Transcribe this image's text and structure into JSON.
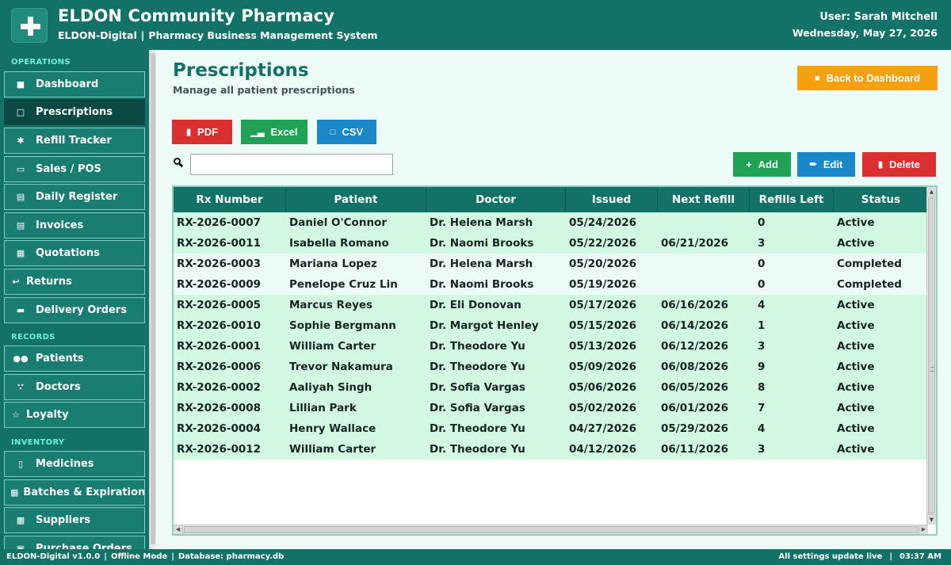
{
  "header": {
    "title": "ELDON Community Pharmacy",
    "subtitle_brand": "ELDON-Digital",
    "subtitle_separator": "|",
    "subtitle_system": "Pharmacy Business Management System",
    "user": "User: Sarah Mitchell",
    "date": "Wednesday, May 27, 2026"
  },
  "sidebar": {
    "section_operations": "OPERATIONS",
    "section_records": "RECORDS",
    "section_inventory": "INVENTORY",
    "items": [
      {
        "label": "Dashboard",
        "icon": "home-icon"
      },
      {
        "label": "Prescriptions",
        "icon": "clipboard-icon"
      },
      {
        "label": "Refill Tracker",
        "icon": "gear-icon"
      },
      {
        "label": "Sales / POS",
        "icon": "card-icon"
      },
      {
        "label": "Daily Register",
        "icon": "book-icon"
      },
      {
        "label": "Invoices",
        "icon": "receipt-icon"
      },
      {
        "label": "Quotations",
        "icon": "document-icon"
      },
      {
        "label": "Returns",
        "icon": "return-arrow-icon"
      },
      {
        "label": "Delivery Orders",
        "icon": "truck-icon"
      },
      {
        "label": "Patients",
        "icon": "people-icon"
      },
      {
        "label": "Doctors",
        "icon": "stethoscope-icon"
      },
      {
        "label": "Loyalty",
        "icon": "star-icon"
      },
      {
        "label": "Medicines",
        "icon": "pill-bottle-icon"
      },
      {
        "label": "Batches & Expiration",
        "icon": "calendar-icon"
      },
      {
        "label": "Suppliers",
        "icon": "package-icon"
      },
      {
        "label": "Purchase Orders",
        "icon": "cart-icon"
      }
    ],
    "active_index": 1
  },
  "page": {
    "title": "Prescriptions",
    "subtitle": "Manage all patient prescriptions",
    "back_label": "Back to Dashboard"
  },
  "export": {
    "pdf": "PDF",
    "excel": "Excel",
    "csv": "CSV"
  },
  "actions": {
    "add": "Add",
    "edit": "Edit",
    "delete": "Delete"
  },
  "search": {
    "value": "",
    "placeholder": ""
  },
  "table": {
    "columns": [
      "Rx Number",
      "Patient",
      "Doctor",
      "Issued",
      "Next Refill",
      "Refills Left",
      "Status"
    ],
    "rows": [
      [
        "RX-2026-0007",
        "Daniel O'Connor",
        "Dr. Helena Marsh",
        "05/24/2026",
        "",
        "0",
        "Active"
      ],
      [
        "RX-2026-0011",
        "Isabella Romano",
        "Dr. Naomi Brooks",
        "05/22/2026",
        "06/21/2026",
        "3",
        "Active"
      ],
      [
        "RX-2026-0003",
        "Mariana Lopez",
        "Dr. Helena Marsh",
        "05/20/2026",
        "",
        "0",
        "Completed"
      ],
      [
        "RX-2026-0009",
        "Penelope Cruz Lin",
        "Dr. Naomi Brooks",
        "05/19/2026",
        "",
        "0",
        "Completed"
      ],
      [
        "RX-2026-0005",
        "Marcus Reyes",
        "Dr. Eli Donovan",
        "05/17/2026",
        "06/16/2026",
        "4",
        "Active"
      ],
      [
        "RX-2026-0010",
        "Sophie Bergmann",
        "Dr. Margot Henley",
        "05/15/2026",
        "06/14/2026",
        "1",
        "Active"
      ],
      [
        "RX-2026-0001",
        "William Carter",
        "Dr. Theodore Yu",
        "05/13/2026",
        "06/12/2026",
        "3",
        "Active"
      ],
      [
        "RX-2026-0006",
        "Trevor Nakamura",
        "Dr. Theodore Yu",
        "05/09/2026",
        "06/08/2026",
        "9",
        "Active"
      ],
      [
        "RX-2026-0002",
        "Aaliyah Singh",
        "Dr. Sofia Vargas",
        "05/06/2026",
        "06/05/2026",
        "8",
        "Active"
      ],
      [
        "RX-2026-0008",
        "Lillian Park",
        "Dr. Sofia Vargas",
        "05/02/2026",
        "06/01/2026",
        "7",
        "Active"
      ],
      [
        "RX-2026-0004",
        "Henry Wallace",
        "Dr. Theodore Yu",
        "04/27/2026",
        "05/29/2026",
        "4",
        "Active"
      ],
      [
        "RX-2026-0012",
        "William Carter",
        "Dr. Theodore Yu",
        "04/12/2026",
        "06/11/2026",
        "3",
        "Active"
      ]
    ]
  },
  "statusbar": {
    "version": "ELDON-Digital v1.0.0",
    "mode": "Offline Mode",
    "database": "Database: pharmacy.db",
    "settings": "All settings update live",
    "time": "03:37 AM",
    "separator": "|"
  },
  "colors": {
    "primary": "#127267",
    "active_row": "#d3f8e2",
    "completed_row": "#ecfbf5",
    "back_button": "#f4a00f",
    "danger": "#dc2f2f",
    "success": "#1fa253",
    "info": "#1a87c8",
    "section_label": "#6ff0d6"
  }
}
